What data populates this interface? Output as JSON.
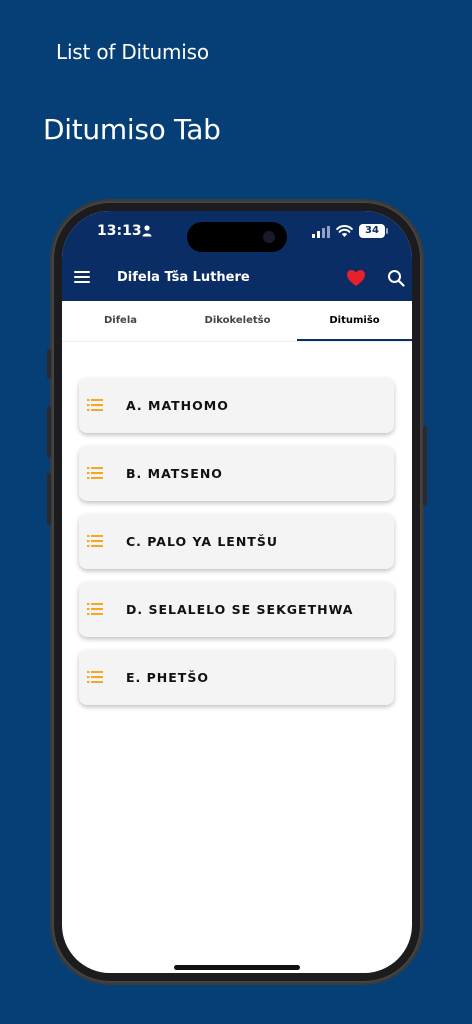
{
  "caption": "List of Ditumiso",
  "headline": "Ditumiso Tab",
  "status_bar": {
    "time": "13:13",
    "battery": "34"
  },
  "app_bar": {
    "title": "Difela Tša Luthere"
  },
  "tabs": [
    {
      "label": "Difela",
      "active": false
    },
    {
      "label": "Dikokeletšo",
      "active": false
    },
    {
      "label": "Ditumišo",
      "active": true
    }
  ],
  "list_items": [
    {
      "label": "A. MATHOMO"
    },
    {
      "label": "B. MATSENO"
    },
    {
      "label": "C. PALO YA LENTŠU"
    },
    {
      "label": "D. SELALELO SE SEKGETHWA"
    },
    {
      "label": "E. PHETŠO"
    }
  ],
  "colors": {
    "background": "#063f76",
    "app_bar": "#0b2d66",
    "heart": "#e8202a",
    "list_icon": "#f5a623",
    "card": "#f4f4f4"
  },
  "icons": {
    "menu": "menu-icon",
    "favorite": "heart-icon",
    "search": "search-icon",
    "list_item": "list-icon"
  }
}
